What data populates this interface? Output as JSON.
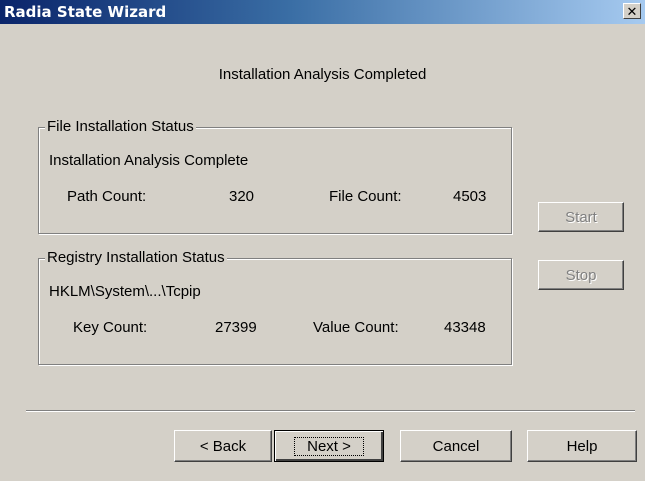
{
  "window": {
    "title": "Radia State Wizard",
    "close_glyph": "✕"
  },
  "header": {
    "text": "Installation Analysis Completed"
  },
  "file_group": {
    "legend": "File Installation Status",
    "status": "Installation Analysis Complete",
    "path_label": "Path Count:",
    "path_value": "320",
    "file_label": "File Count:",
    "file_value": "4503"
  },
  "registry_group": {
    "legend": "Registry Installation Status",
    "status": "HKLM\\System\\...\\Tcpip",
    "key_label": "Key Count:",
    "key_value": "27399",
    "value_label": "Value Count:",
    "value_value": "43348"
  },
  "side_buttons": {
    "start": "Start",
    "stop": "Stop"
  },
  "footer_buttons": {
    "back": "< Back",
    "next": "Next >",
    "cancel": "Cancel",
    "help": "Help"
  }
}
